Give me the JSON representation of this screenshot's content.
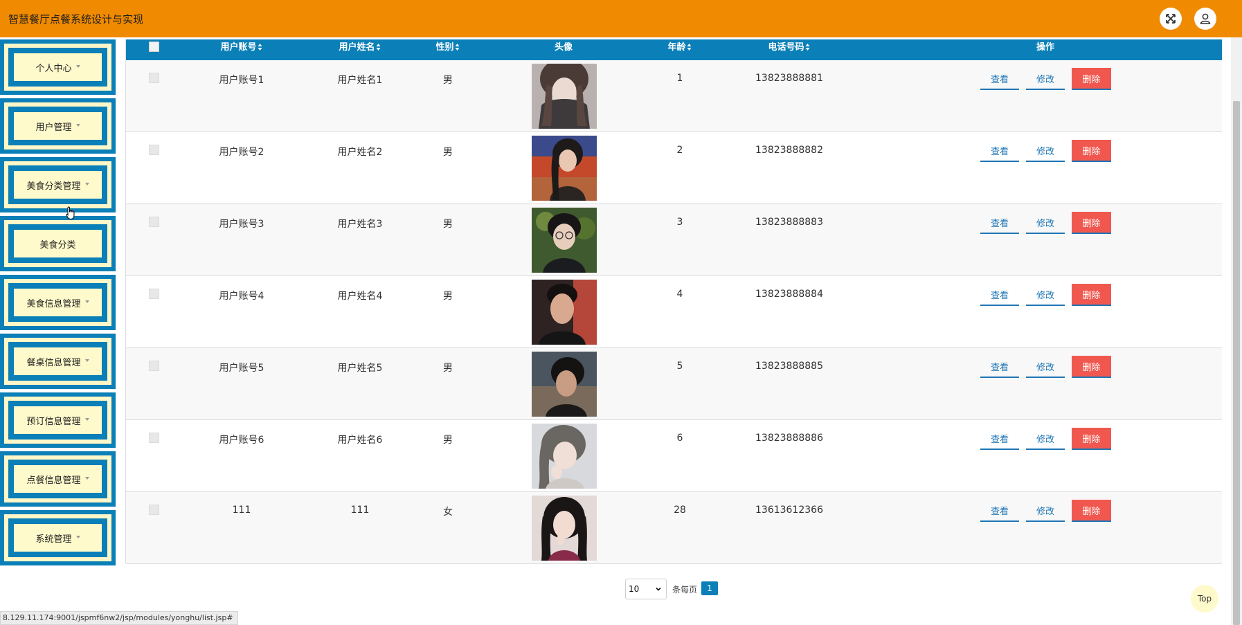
{
  "header": {
    "title": "智慧餐厅点餐系统设计与实现",
    "bg_color": "#f08a00",
    "actions": [
      {
        "name": "fullscreen-icon"
      },
      {
        "name": "user-icon"
      }
    ]
  },
  "sidebar": {
    "items": [
      {
        "label": "个人中心",
        "dropdown": true
      },
      {
        "label": "用户管理",
        "dropdown": true
      },
      {
        "label": "美食分类管理",
        "dropdown": true
      },
      {
        "label": "美食分类",
        "dropdown": false
      },
      {
        "label": "美食信息管理",
        "dropdown": true
      },
      {
        "label": "餐桌信息管理",
        "dropdown": true
      },
      {
        "label": "预订信息管理",
        "dropdown": true
      },
      {
        "label": "点餐信息管理",
        "dropdown": true
      },
      {
        "label": "系统管理",
        "dropdown": true
      }
    ]
  },
  "table": {
    "header_color": "#0b7fb7",
    "columns": [
      "用户账号",
      "用户姓名",
      "性别",
      "头像",
      "年龄",
      "电话号码",
      "操作"
    ],
    "rows": [
      {
        "account": "用户账号1",
        "name": "用户姓名1",
        "gender": "男",
        "age": "1",
        "phone": "13823888881"
      },
      {
        "account": "用户账号2",
        "name": "用户姓名2",
        "gender": "男",
        "age": "2",
        "phone": "13823888882"
      },
      {
        "account": "用户账号3",
        "name": "用户姓名3",
        "gender": "男",
        "age": "3",
        "phone": "13823888883"
      },
      {
        "account": "用户账号4",
        "name": "用户姓名4",
        "gender": "男",
        "age": "4",
        "phone": "13823888884"
      },
      {
        "account": "用户账号5",
        "name": "用户姓名5",
        "gender": "男",
        "age": "5",
        "phone": "13823888885"
      },
      {
        "account": "用户账号6",
        "name": "用户姓名6",
        "gender": "男",
        "age": "6",
        "phone": "13823888886"
      },
      {
        "account": "111",
        "name": "111",
        "gender": "女",
        "age": "28",
        "phone": "13613612366"
      }
    ],
    "actions": {
      "view": "查看",
      "edit": "修改",
      "delete": "删除"
    },
    "delete_color": "#f0584f"
  },
  "pagination": {
    "page_size": "10",
    "per_page_label": "条每页",
    "current_page": "1"
  },
  "back_to_top": "Top",
  "status_url": "8.129.11.174:9001/jspmf6nw2/jsp/modules/yonghu/list.jsp#"
}
